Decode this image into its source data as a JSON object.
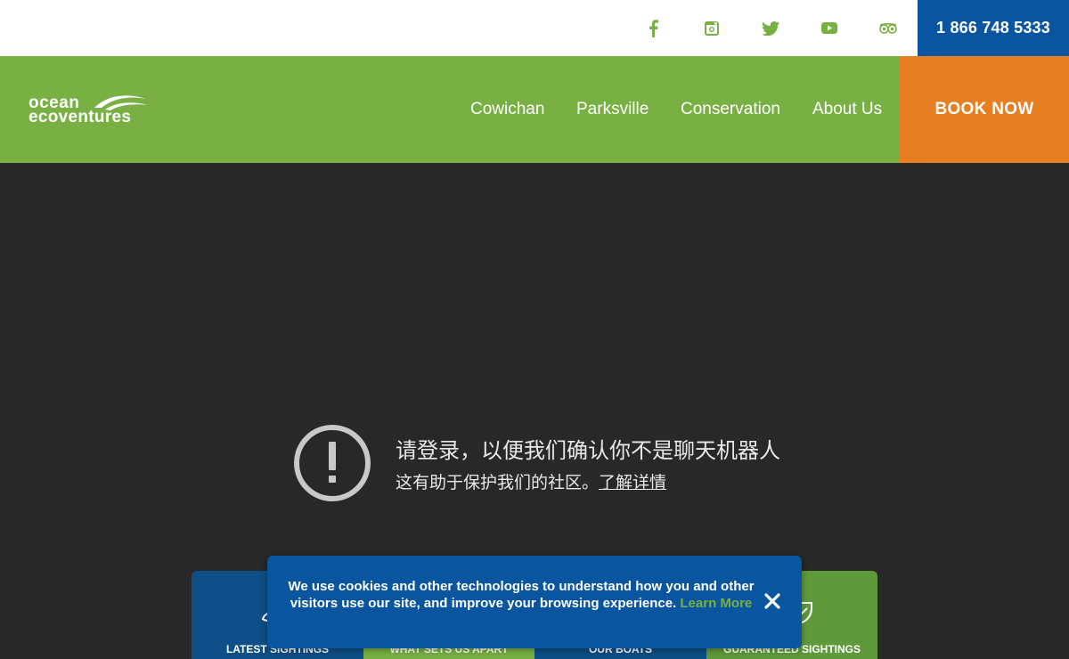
{
  "topbar": {
    "social_icons": [
      "facebook-icon",
      "instagram-icon",
      "twitter-icon",
      "youtube-icon",
      "tripadvisor-icon"
    ],
    "phone": "1 866 748 5333"
  },
  "logo": {
    "line1": "ocean",
    "line2": "ecoventures"
  },
  "nav": {
    "links": [
      "Cowichan",
      "Parksville",
      "Conservation",
      "About Us"
    ],
    "book_label": "BOOK NOW"
  },
  "error": {
    "title": "请登录，以便我们确认你不是聊天机器人",
    "subtitle": "这有助于保护我们的社区。",
    "learn_more": "了解详情"
  },
  "cards": [
    {
      "label": "LATEST SIGHTINGS",
      "icon": "whale-icon"
    },
    {
      "label": "WHAT SETS US APART",
      "icon": "star-icon"
    },
    {
      "label": "OUR BOATS",
      "icon": "boat-icon"
    },
    {
      "label": "GUARANTEED SIGHTINGS",
      "icon": "badge-icon"
    }
  ],
  "cookie": {
    "message": "We use cookies and other technologies to understand how you and other visitors use our site, and improve your browsing experience.",
    "link": "Learn More"
  },
  "colors": {
    "green": "#78b043",
    "blue": "#0a55a0",
    "orange": "#e67e22",
    "dark_bg": "#282828"
  }
}
